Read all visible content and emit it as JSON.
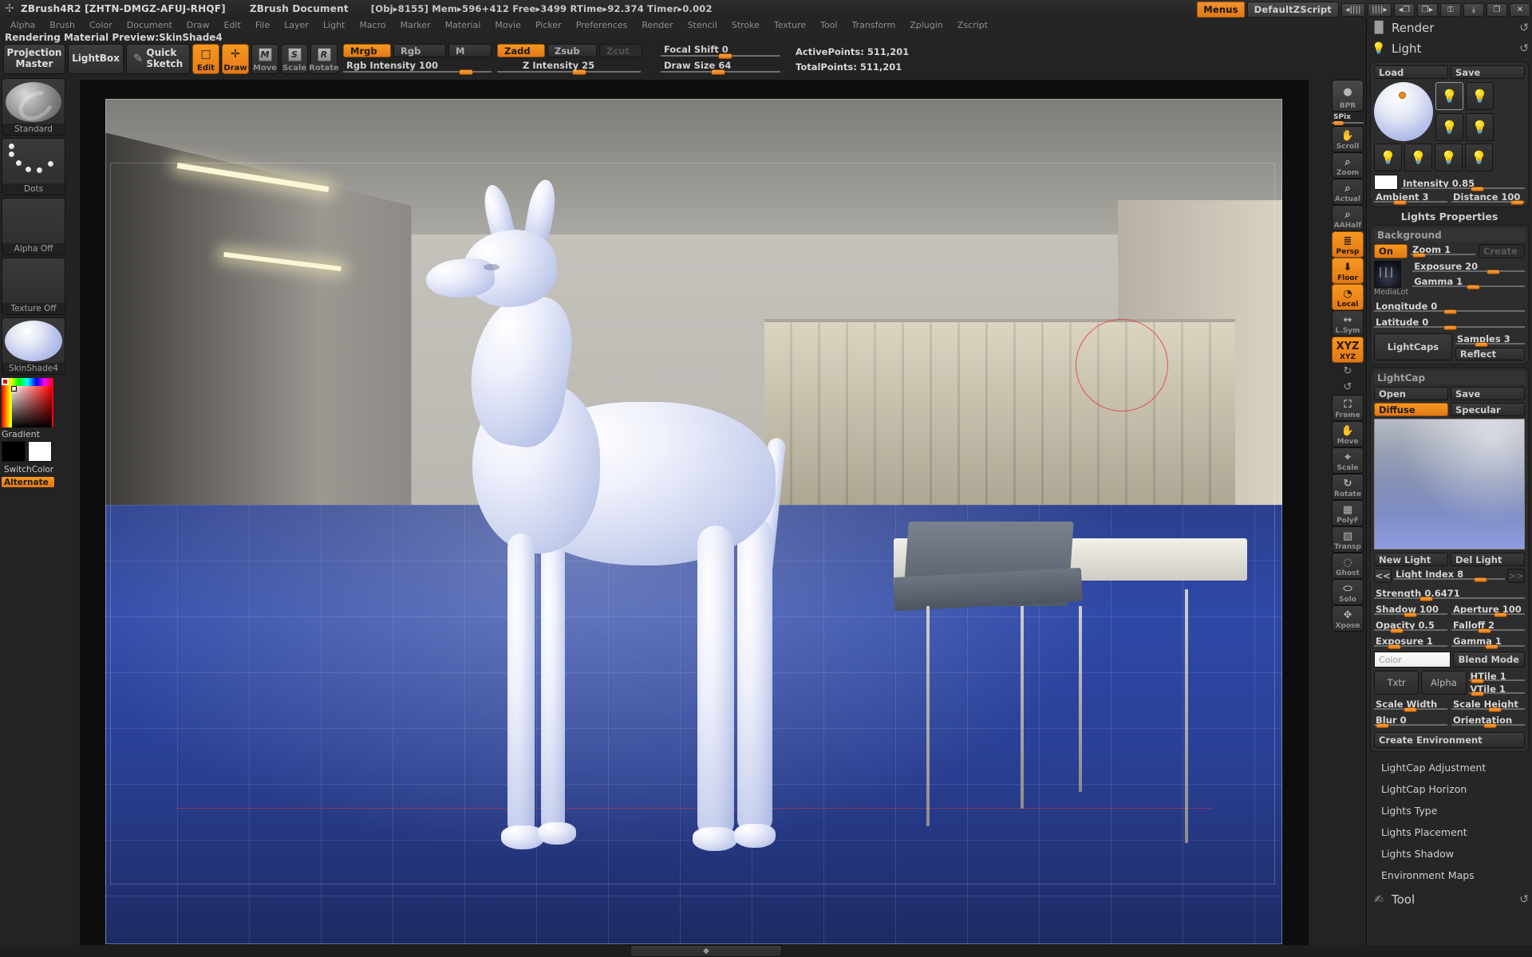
{
  "titlebar": {
    "app_title": "ZBrush4R2 [ZHTN-DMGZ-AFUJ-RHQF]",
    "document_title": "ZBrush Document",
    "stats": "[Obj▸8155] Mem▸596+412 Free▸3499 RTime▸92.374 Timer▸0.002",
    "menus_button": "Menus",
    "zscript_button": "DefaultZScript",
    "nav_prev": "◂||||",
    "nav_next": "||||▸",
    "tray_left": "◂❐",
    "tray_right": "❐▸",
    "lock": "⚿",
    "minimize": "⤓",
    "restore": "❐",
    "close": "✕"
  },
  "menubar": {
    "items": [
      "Alpha",
      "Brush",
      "Color",
      "Document",
      "Draw",
      "Edit",
      "File",
      "Layer",
      "Light",
      "Macro",
      "Marker",
      "Material",
      "Movie",
      "Picker",
      "Preferences",
      "Render",
      "Stencil",
      "Stroke",
      "Texture",
      "Tool",
      "Transform",
      "Zplugin",
      "Zscript"
    ]
  },
  "statusline": "Rendering Material Preview:SkinShade4",
  "toolbar": {
    "projection_master": "Projection\nMaster",
    "lightbox": "LightBox",
    "quick_sketch": "Quick\nSketch",
    "edit": "Edit",
    "draw": "Draw",
    "move": "Move",
    "scale": "Scale",
    "rotate": "Rotate",
    "mrgb": "Mrgb",
    "rgb": "Rgb",
    "m": "M",
    "zadd": "Zadd",
    "zsub": "Zsub",
    "zcut": "Zcut",
    "rgb_intensity_label": "Rgb Intensity 100",
    "rgb_intensity_value": 100,
    "z_intensity_label": "Z Intensity 25",
    "z_intensity_value": 25,
    "focal_shift_label": "Focal Shift 0",
    "focal_shift_value": 0,
    "draw_size_label": "Draw Size 64",
    "draw_size_value": 64,
    "active_points": "ActivePoints: 511,201",
    "total_points": "TotalPoints: 511,201"
  },
  "leftshelf": {
    "brush_name": "Standard",
    "stroke_name": "Dots",
    "alpha_name": "Alpha Off",
    "texture_name": "Texture Off",
    "material_name": "SkinShade4",
    "gradient_label": "Gradient",
    "switchcolor_label": "SwitchColor",
    "alternate_label": "Alternate"
  },
  "rightshelf": {
    "bpr": "BPR",
    "spix_label": "SPix",
    "items": [
      {
        "label": "Scroll",
        "icon": "hand-icon",
        "active": false
      },
      {
        "label": "Zoom",
        "icon": "magnifier-plus-icon",
        "active": false
      },
      {
        "label": "Actual",
        "icon": "magnifier-one-icon",
        "active": false
      },
      {
        "label": "AAHalf",
        "icon": "magnifier-half-icon",
        "active": false
      },
      {
        "label": "Persp",
        "icon": "perspective-icon",
        "active": true
      },
      {
        "label": "Floor",
        "icon": "floor-icon",
        "active": true
      },
      {
        "label": "Local",
        "icon": "local-icon",
        "active": true
      },
      {
        "label": "L.Sym",
        "icon": "symmetry-icon",
        "active": false
      },
      {
        "label": "XYZ",
        "icon": "xyz-icon",
        "active": true
      },
      {
        "label": "Frame",
        "icon": "frame-icon",
        "active": false
      },
      {
        "label": "Move",
        "icon": "move-hand-icon",
        "active": false
      },
      {
        "label": "Scale",
        "icon": "scale-icon",
        "active": false
      },
      {
        "label": "Rotate",
        "icon": "rotate-icon",
        "active": false
      },
      {
        "label": "PolyF",
        "icon": "polyframe-icon",
        "active": false
      },
      {
        "label": "Transp",
        "icon": "transparency-icon",
        "active": false
      },
      {
        "label": "Ghost",
        "icon": "ghost-icon",
        "active": false
      },
      {
        "label": "Solo",
        "icon": "solo-icon",
        "active": false
      },
      {
        "label": "Xpose",
        "icon": "xpose-icon",
        "active": false
      }
    ],
    "rot_y": "↻",
    "rot_z": "↺"
  },
  "rightpanel": {
    "render_title": "Render",
    "light_title": "Light",
    "reset_icon": "↺",
    "light": {
      "load": "Load",
      "save": "Save",
      "intensity_label": "Intensity 0.85",
      "intensity_value": 0.85,
      "ambient_label": "Ambient 3",
      "ambient_value": 3,
      "distance_label": "Distance 100",
      "distance_value": 100
    },
    "lights_properties_title": "Lights Properties",
    "background": {
      "title": "Background",
      "on": "On",
      "zoom_label": "Zoom 1",
      "zoom_value": 1,
      "create": "Create",
      "thumb_caption": "MediaLot",
      "exposure_label": "Exposure 20",
      "exposure_value": 20,
      "gamma_label": "Gamma 1",
      "gamma_value": 1,
      "longitude_label": "Longitude 0",
      "longitude_value": 0,
      "latitude_label": "Latitude 0",
      "latitude_value": 0,
      "lightcaps": "LightCaps",
      "samples_label": "Samples 3",
      "samples_value": 3,
      "reflect": "Reflect"
    },
    "lightcap": {
      "title": "LightCap",
      "open": "Open",
      "save": "Save",
      "diffuse": "Diffuse",
      "specular": "Specular",
      "new_light": "New Light",
      "del_light": "Del Light",
      "prev": "<<",
      "next": ">>",
      "light_index_label": "Light Index 8",
      "light_index_value": 8,
      "strength_label": "Strength 0.6471",
      "strength_value": 0.6471,
      "shadow_label": "Shadow 100",
      "shadow_value": 100,
      "aperture_label": "Aperture 100",
      "aperture_value": 100,
      "opacity_label": "Opacity 0.5",
      "opacity_value": 0.5,
      "falloff_label": "Falloff 2",
      "falloff_value": 2,
      "exposure_label": "Exposure 1",
      "exposure_value": 1,
      "gamma_label": "Gamma 1",
      "gamma_value": 1,
      "color_placeholder": "Color",
      "blend_mode": "Blend Mode",
      "txtr": "Txtr",
      "alpha": "Alpha",
      "htile_label": "HTile 1",
      "htile_value": 1,
      "vtile_label": "VTile 1",
      "vtile_value": 1,
      "scale_width_label": "Scale Width",
      "scale_height_label": "Scale Height",
      "blur_label": "Blur 0",
      "blur_value": 0,
      "orientation_label": "Orientation",
      "create_environment": "Create Environment"
    },
    "subpalettes": [
      "LightCap Adjustment",
      "LightCap Horizon",
      "Lights Type",
      "Lights Placement",
      "Lights Shadow",
      "Environment Maps"
    ],
    "tool_title": "Tool"
  },
  "colors": {
    "accent_orange": "#f0861c",
    "panel_bg": "#262626",
    "canvas_bg": "#0d0d0d",
    "text": "#cfcfcf"
  }
}
